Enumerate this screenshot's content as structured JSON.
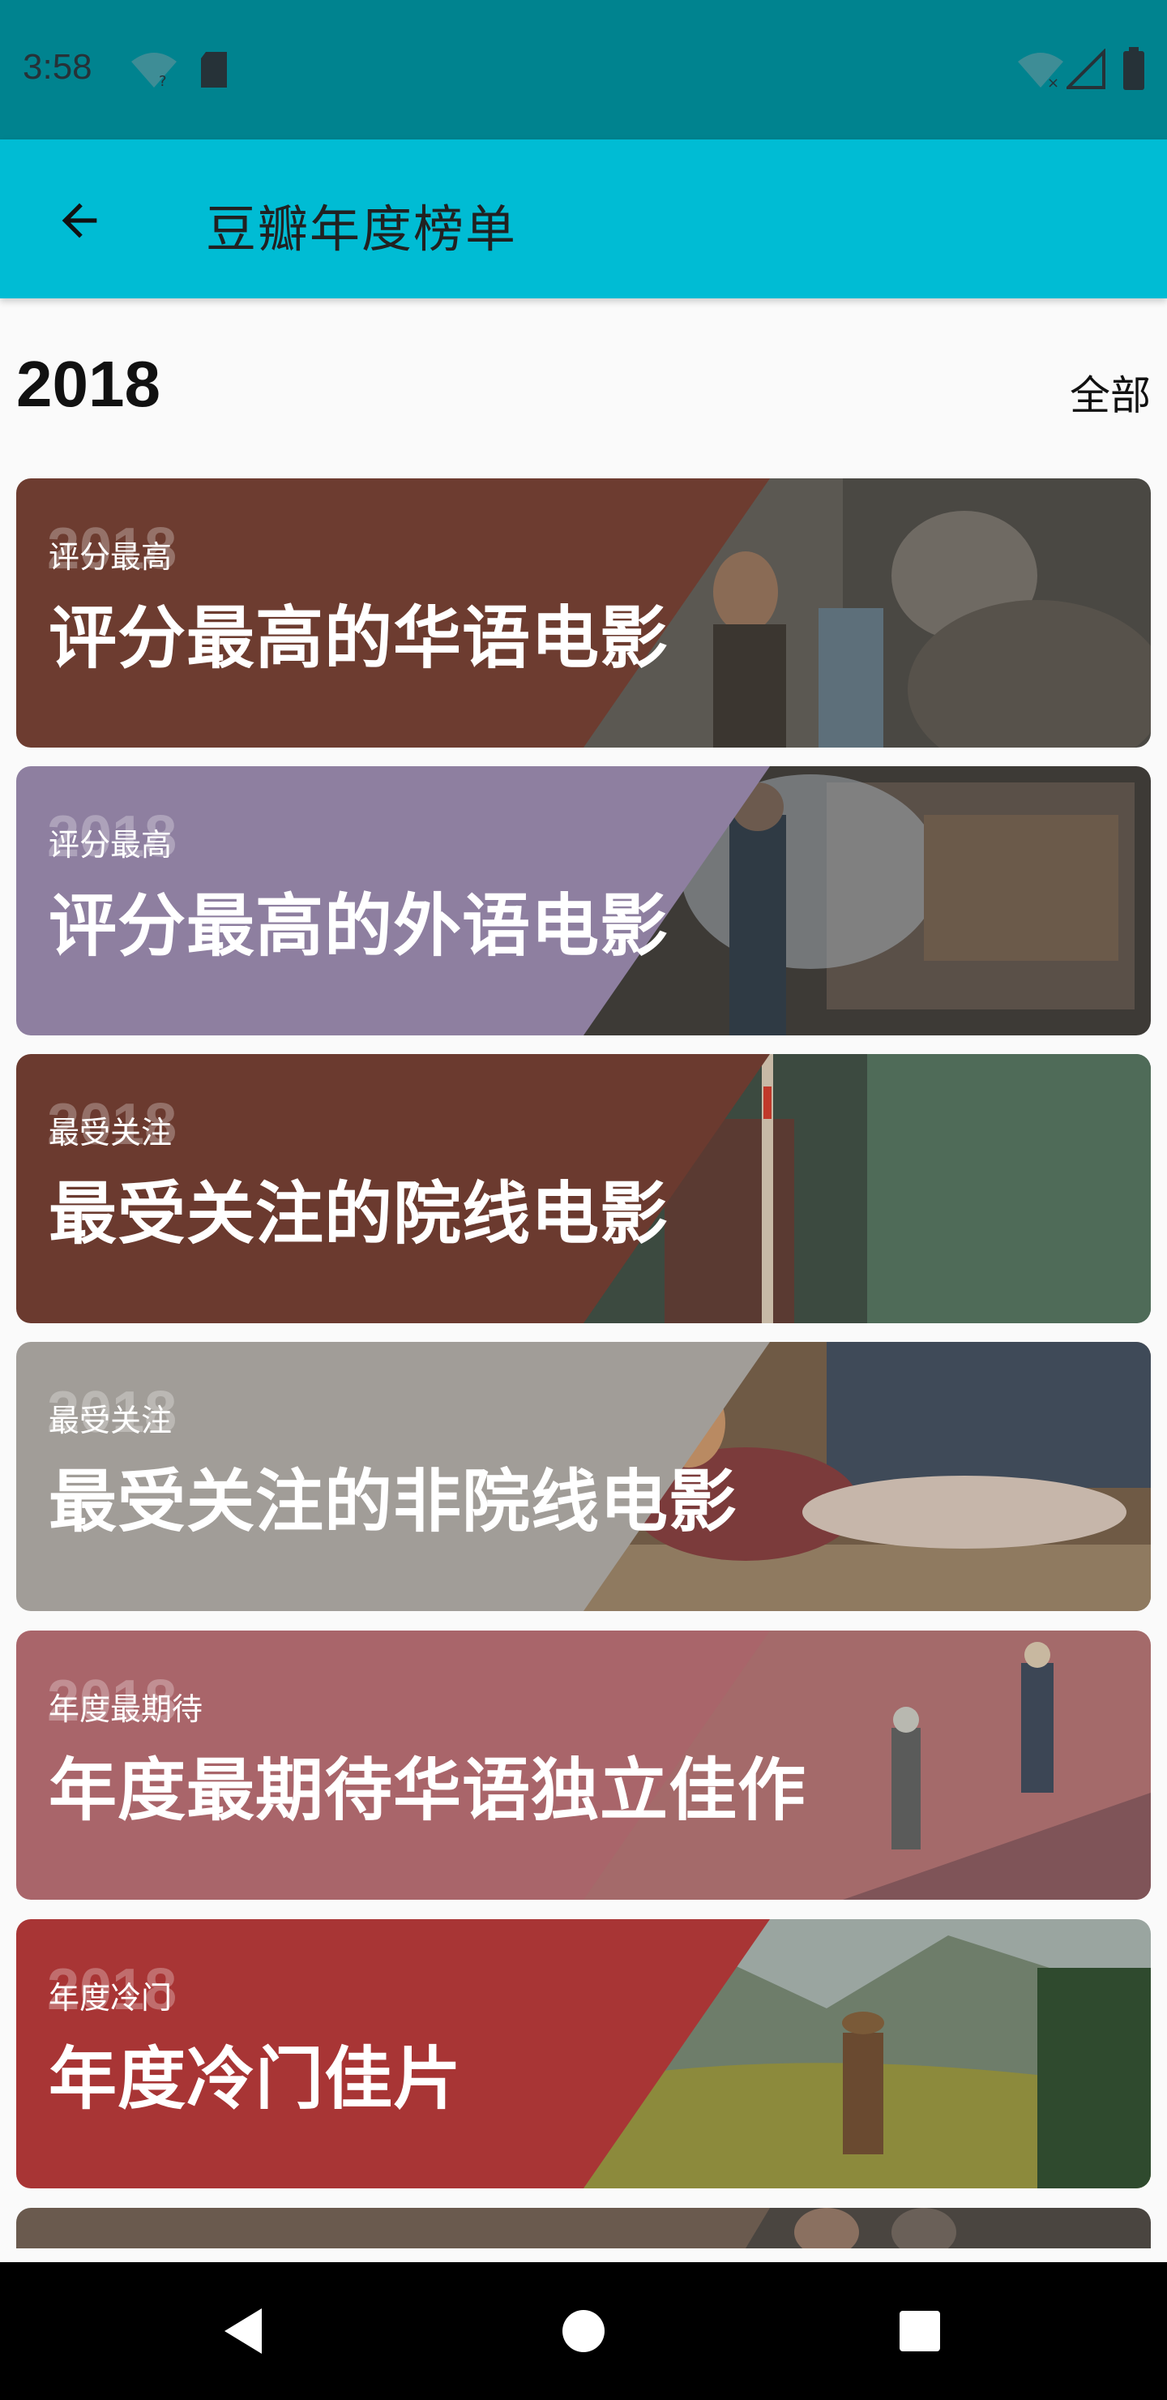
{
  "status_bar": {
    "time": "3:58"
  },
  "app_bar": {
    "title": "豆瓣年度榜单"
  },
  "header": {
    "year": "2018",
    "all_link": "全部"
  },
  "cards": [
    {
      "year": "2018",
      "subtitle": "评分最高",
      "title": "评分最高的华语电影",
      "band_color": "#6d3c30"
    },
    {
      "year": "2018",
      "subtitle": "评分最高",
      "title": "评分最高的外语电影",
      "band_color": "#8e7fa0"
    },
    {
      "year": "2018",
      "subtitle": "最受关注",
      "title": "最受关注的院线电影",
      "band_color": "#6b3a2f"
    },
    {
      "year": "2018",
      "subtitle": "最受关注",
      "title": "最受关注的非院线电影",
      "band_color": "#a19d98"
    },
    {
      "year": "2018",
      "subtitle": "年度最期待",
      "title": "年度最期待华语独立佳作",
      "band_color": "#a9656a"
    },
    {
      "year": "2018",
      "subtitle": "年度冷门",
      "title": "年度冷门佳片",
      "band_color": "#a83535"
    }
  ],
  "colors": {
    "status_bar": "#00838f",
    "app_bar": "#00bcd4",
    "background": "#fafafa"
  }
}
